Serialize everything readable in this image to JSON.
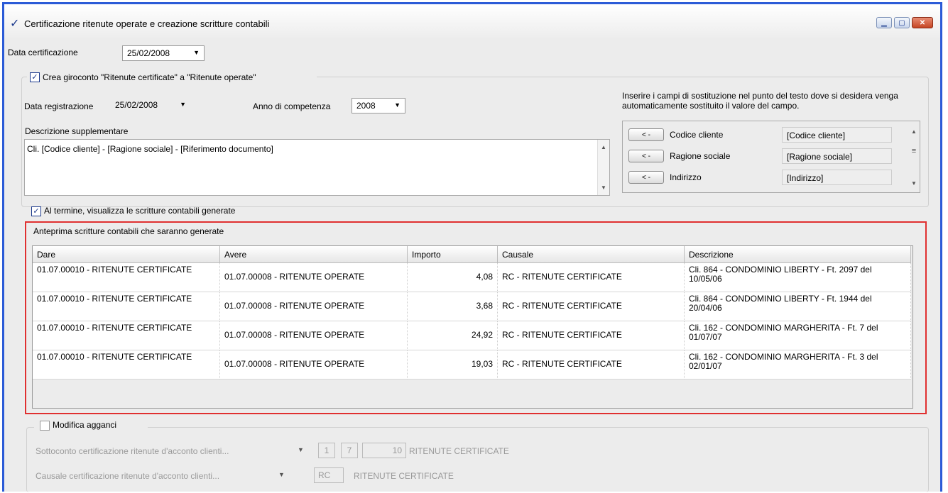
{
  "window": {
    "title": "Certificazione ritenute operate e creazione scritture contabili",
    "buttons": [
      "minimize",
      "maximize",
      "close"
    ]
  },
  "data_certificazione": {
    "label": "Data certificazione",
    "value": "25/02/2008"
  },
  "giroconto": {
    "checked": true,
    "label": "Crea giroconto \"Ritenute certificate\" a \"Ritenute operate\"",
    "data_registrazione": {
      "label": "Data registrazione",
      "value": "25/02/2008"
    },
    "anno": {
      "label": "Anno di competenza",
      "value": "2008"
    },
    "descrizione": {
      "label": "Descrizione supplementare",
      "value": "Cli. [Codice cliente] - [Ragione sociale] - [Riferimento documento]"
    },
    "help_text": "Inserire i campi di sostituzione nel punto del testo dove si desidera venga automaticamente sostituito il valore del campo.",
    "fields": [
      {
        "button": "< -",
        "label": "Codice cliente",
        "value": "[Codice cliente]"
      },
      {
        "button": "< -",
        "label": "Ragione sociale",
        "value": "[Ragione sociale]"
      },
      {
        "button": "< -",
        "label": "Indirizzo",
        "value": "[Indirizzo]"
      }
    ]
  },
  "visualizza": {
    "checked": true,
    "label": "Al termine, visualizza le scritture contabili generate"
  },
  "anteprima": {
    "title": "Anteprima scritture contabili che saranno generate",
    "columns": [
      "Dare",
      "Avere",
      "Importo",
      "Causale",
      "Descrizione"
    ],
    "rows": [
      [
        "01.07.00010 - RITENUTE CERTIFICATE",
        "01.07.00008 - RITENUTE OPERATE",
        "4,08",
        "RC - RITENUTE CERTIFICATE",
        "Cli. 864 - CONDOMINIO LIBERTY - Ft. 2097 del 10/05/06"
      ],
      [
        "01.07.00010 - RITENUTE CERTIFICATE",
        "01.07.00008 - RITENUTE OPERATE",
        "3,68",
        "RC - RITENUTE CERTIFICATE",
        "Cli. 864 - CONDOMINIO LIBERTY - Ft. 1944 del 20/04/06"
      ],
      [
        "01.07.00010 - RITENUTE CERTIFICATE",
        "01.07.00008 - RITENUTE OPERATE",
        "24,92",
        "RC - RITENUTE CERTIFICATE",
        "Cli. 162 - CONDOMINIO MARGHERITA - Ft. 7 del 01/07/07"
      ],
      [
        "01.07.00010 - RITENUTE CERTIFICATE",
        "01.07.00008 - RITENUTE OPERATE",
        "19,03",
        "RC - RITENUTE CERTIFICATE",
        "Cli. 162 - CONDOMINIO MARGHERITA - Ft. 3 del 02/01/07"
      ]
    ]
  },
  "agganci": {
    "checked": false,
    "label": "Modifica agganci",
    "sottoconto": {
      "label": "Sottoconto certificazione ritenute d'acconto clienti...",
      "code1": "1",
      "code2": "7",
      "code3": "10",
      "desc": "RITENUTE CERTIFICATE"
    },
    "causale": {
      "label": "Causale certificazione ritenute d'acconto clienti...",
      "code": "RC",
      "desc": "RITENUTE CERTIFICATE"
    }
  },
  "colors": {
    "accent": "#2b5bd7",
    "highlight_border": "#e03030"
  }
}
